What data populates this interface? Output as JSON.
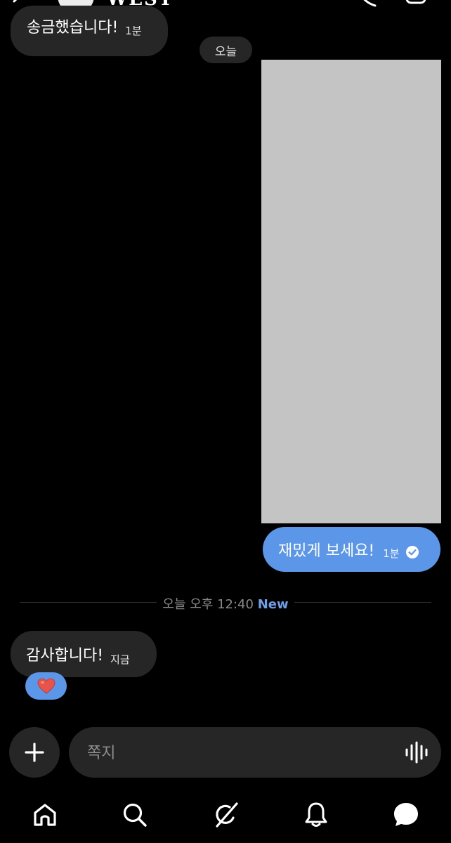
{
  "header": {
    "name": "WEST",
    "back_icon": "chevron-left-icon",
    "call_icon": "phone-icon",
    "video_icon": "video-camera-icon"
  },
  "messages": {
    "top": {
      "text": "송금했습니다!",
      "time": "1분"
    },
    "date_chip": "오늘",
    "outgoing": {
      "text": "재밌게 보세요!",
      "time": "1분",
      "status_icon": "check-circle-icon"
    },
    "divider": {
      "label": "오늘 오후 12:40",
      "new_label": "New"
    },
    "bottom": {
      "text": "감사합니다!",
      "time": "지금",
      "reaction": "❤️"
    }
  },
  "composer": {
    "placeholder": "쪽지",
    "plus_icon": "plus-icon",
    "voice_icon": "voice-wave-icon"
  },
  "nav": {
    "items": [
      "home-icon",
      "search-icon",
      "grok-icon",
      "bell-icon",
      "chat-icon"
    ]
  },
  "colors": {
    "background": "#000000",
    "incoming_bubble": "#262626",
    "outgoing_bubble": "#5b96e8",
    "new_label": "#6f9fe6",
    "image_placeholder": "#c4c4c4"
  }
}
